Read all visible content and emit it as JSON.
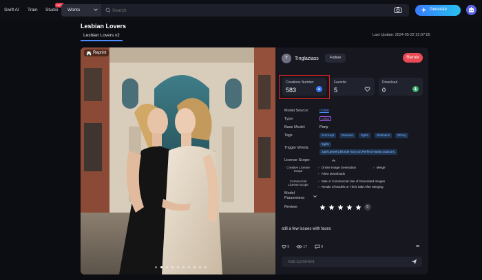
{
  "nav": {
    "logo": "Swift AI",
    "items": [
      {
        "label": "Train"
      },
      {
        "label": "Studio",
        "badge": "NEW"
      }
    ],
    "search": {
      "category": "Works",
      "placeholder": "Search"
    },
    "generate_label": "Generate"
  },
  "page": {
    "title": "Lesbian Lovers",
    "version_tab": "Lesbian Lovers v2",
    "last_update": "Last Update:  2024-05-22 22:07:55"
  },
  "image": {
    "reprint_label": "Reprint",
    "slide_count": 10,
    "active_slide": 1
  },
  "author": {
    "initial": "T",
    "name": "Tinglaziass",
    "follow_label": "Follow",
    "remix_label": "Remix"
  },
  "stats": [
    {
      "label": "Creations Number",
      "value": "583",
      "icon": "play-icon",
      "color": "#3a7bfd"
    },
    {
      "label": "Favorite",
      "value": "5",
      "icon": "heart-icon",
      "color": "#6a6d7c"
    },
    {
      "label": "Download",
      "value": "0",
      "icon": "download-icon",
      "color": "#3bb26b"
    }
  ],
  "info": {
    "model_source_label": "Model Source:",
    "model_source_value": "civitai",
    "type_label": "Type:",
    "type_value": "LORA",
    "base_model_label": "Base Model:",
    "base_model_value": "Pony",
    "tags_label": "Tags",
    "tags": [
      "#concept",
      "#woman",
      "#girls",
      "#lesbians",
      "#Pony"
    ],
    "trigger_label": "Trigger Words:",
    "trigger_words": [
      "2girls",
      "2girls,jewelry,blonde hair,yuri,Perfect Hands,outdoors,"
    ],
    "license_label": "License Scope:",
    "creative_label": "Creative License Scope",
    "creative_items": [
      "Online Image Generation",
      "Merge",
      "Allow Downloads"
    ],
    "commercial_label": "Commercial License Scope",
    "commercial_items": [
      "Sale or Commercial Use of Generated Images",
      "Resale of Models or Their Sale After Merging"
    ],
    "params_label": "Model Parameters:",
    "review_label": "Review:",
    "review_stars": 5,
    "review_count": "0"
  },
  "comment": {
    "text": "still a few issues with faces",
    "likes": "5",
    "views": "17",
    "replies": "0",
    "placeholder": "Add Comment"
  }
}
